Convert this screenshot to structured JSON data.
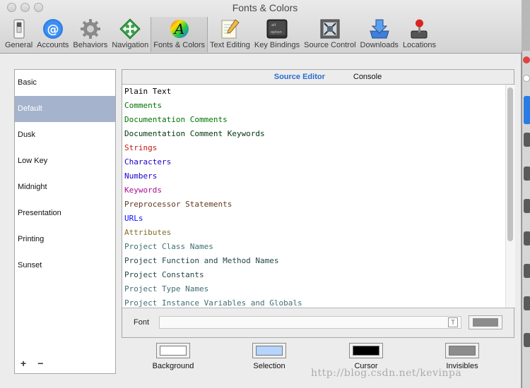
{
  "window": {
    "title": "Fonts & Colors"
  },
  "toolbar": {
    "items": [
      {
        "label": "General",
        "icon": "switch-icon"
      },
      {
        "label": "Accounts",
        "icon": "at-icon"
      },
      {
        "label": "Behaviors",
        "icon": "gear-icon"
      },
      {
        "label": "Navigation",
        "icon": "arrows-icon"
      },
      {
        "label": "Fonts & Colors",
        "icon": "font-color-icon",
        "active": true
      },
      {
        "label": "Text Editing",
        "icon": "pencil-paper-icon"
      },
      {
        "label": "Key Bindings",
        "icon": "keyboard-key-icon"
      },
      {
        "label": "Source Control",
        "icon": "source-control-icon"
      },
      {
        "label": "Downloads",
        "icon": "download-icon"
      },
      {
        "label": "Locations",
        "icon": "joystick-icon"
      }
    ]
  },
  "themes": {
    "items": [
      "Basic",
      "Default",
      "Dusk",
      "Low Key",
      "Midnight",
      "Presentation",
      "Printing",
      "Sunset"
    ],
    "selected": "Default",
    "add_label": "+",
    "remove_label": "−"
  },
  "editor": {
    "tabs": [
      {
        "label": "Source Editor",
        "active": true
      },
      {
        "label": "Console",
        "active": false
      }
    ],
    "syntax_items": [
      {
        "label": "Plain Text",
        "color": "#000000"
      },
      {
        "label": "Comments",
        "color": "#007400"
      },
      {
        "label": "Documentation Comments",
        "color": "#007400"
      },
      {
        "label": "Documentation Comment Keywords",
        "color": "#02350f"
      },
      {
        "label": "Strings",
        "color": "#c41a16"
      },
      {
        "label": "Characters",
        "color": "#1c00cf"
      },
      {
        "label": "Numbers",
        "color": "#1c00cf"
      },
      {
        "label": "Keywords",
        "color": "#aa0d91"
      },
      {
        "label": "Preprocessor Statements",
        "color": "#643820"
      },
      {
        "label": "URLs",
        "color": "#0e0eff"
      },
      {
        "label": "Attributes",
        "color": "#836c28"
      },
      {
        "label": "Project Class Names",
        "color": "#3f6e74"
      },
      {
        "label": "Project Function and Method Names",
        "color": "#26474b"
      },
      {
        "label": "Project Constants",
        "color": "#26474b"
      },
      {
        "label": "Project Type Names",
        "color": "#3f6e74"
      },
      {
        "label": "Project Instance Variables and Globals",
        "color": "#3f6e74"
      }
    ],
    "font_label": "Font",
    "font_value": "",
    "font_button_label": "T",
    "font_color": "#8c8c8c"
  },
  "swatches": [
    {
      "label": "Background",
      "color": "#ffffff"
    },
    {
      "label": "Selection",
      "color": "#b5d5ff"
    },
    {
      "label": "Cursor",
      "color": "#000000"
    },
    {
      "label": "Invisibles",
      "color": "#8c8c8c"
    }
  ],
  "watermark": "http://blog.csdn.net/kevinpa"
}
